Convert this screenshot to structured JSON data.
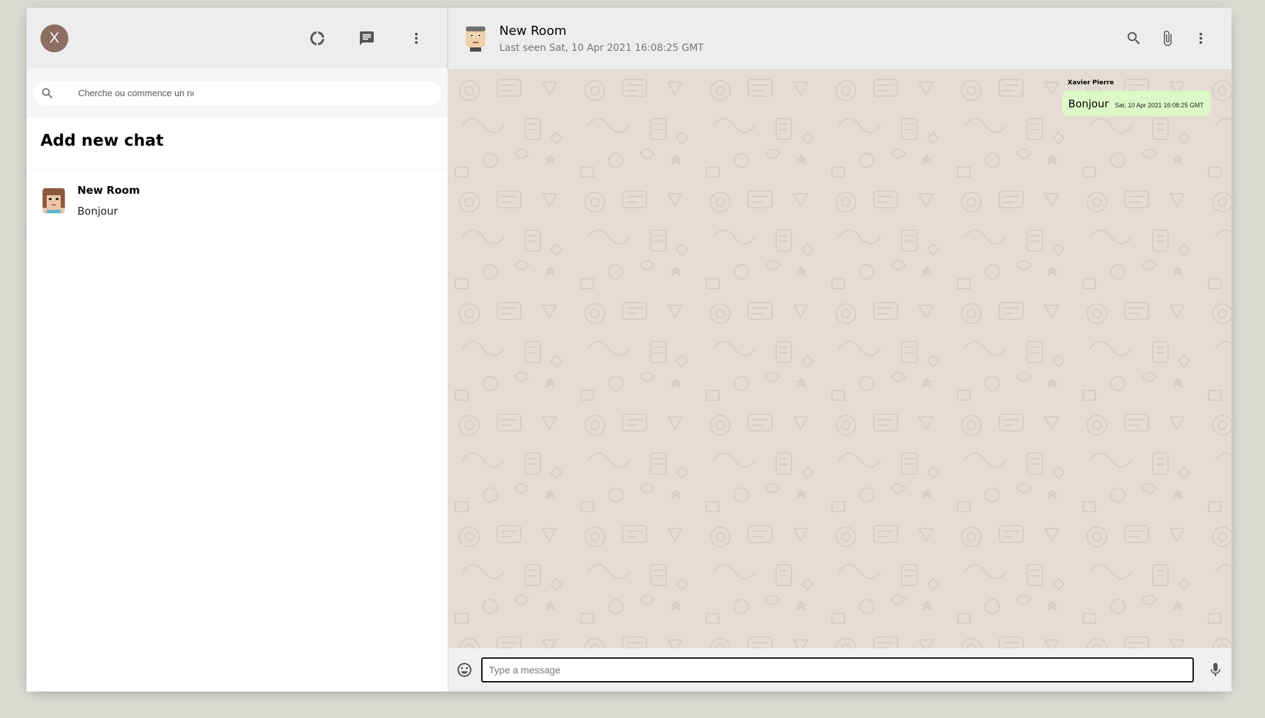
{
  "sidebar": {
    "user_avatar_initial": "X",
    "search_placeholder": "Cherche ou commence un nouveau chat",
    "add_new_chat_label": "Add new chat",
    "chats": [
      {
        "name": "New Room",
        "last_message": "Bonjour"
      }
    ]
  },
  "chat": {
    "room_name": "New Room",
    "last_seen": "Last seen Sat, 10 Apr 2021 16:08:25 GMT",
    "messages": [
      {
        "sender": "Xavier Pierre",
        "text": "Bonjour",
        "timestamp": "Sat, 10 Apr 2021 16:08:25 GMT",
        "is_receiver": true
      }
    ],
    "input_placeholder": "Type a message"
  },
  "colors": {
    "app_background": "#dadbd3",
    "header_background": "#ededed",
    "chat_background": "#e5ddd5",
    "sent_bubble": "#dcf8c6",
    "user_avatar": "#8d6e63",
    "icon": "#919191"
  },
  "icons": {
    "status": "donut-large-icon",
    "new_chat": "chat-icon",
    "menu": "more-vert-icon",
    "search": "search-icon",
    "attach": "attach-file-icon",
    "emoji": "insert-emoticon-icon",
    "mic": "mic-icon"
  }
}
